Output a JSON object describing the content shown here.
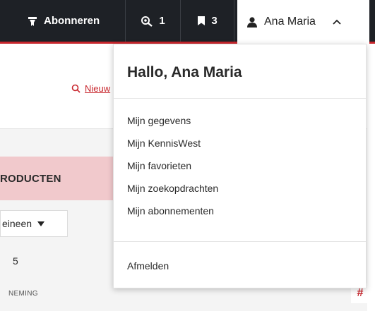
{
  "nav": {
    "subscribe_label": "Abonneren",
    "saved_searches_count": "1",
    "favorites_count": "3",
    "user_name": "Ana Maria"
  },
  "page": {
    "search_link": "Nieuw",
    "products_heading": "RODUCTEN",
    "filter_select_value": "eineen",
    "result_count": "5",
    "column_header": "NEMING",
    "hash_symbol": "#"
  },
  "dropdown": {
    "greeting": "Hallo, Ana Maria",
    "items": [
      {
        "label": "Mijn gegevens"
      },
      {
        "label": "Mijn KennisWest"
      },
      {
        "label": "Mijn favorieten"
      },
      {
        "label": "Mijn zoekopdrachten"
      },
      {
        "label": "Mijn abonnementen"
      }
    ],
    "logout_label": "Afmelden"
  },
  "colors": {
    "nav_bg": "#1e2126",
    "accent": "#c8262d",
    "products_bar": "#f1c9cc"
  }
}
